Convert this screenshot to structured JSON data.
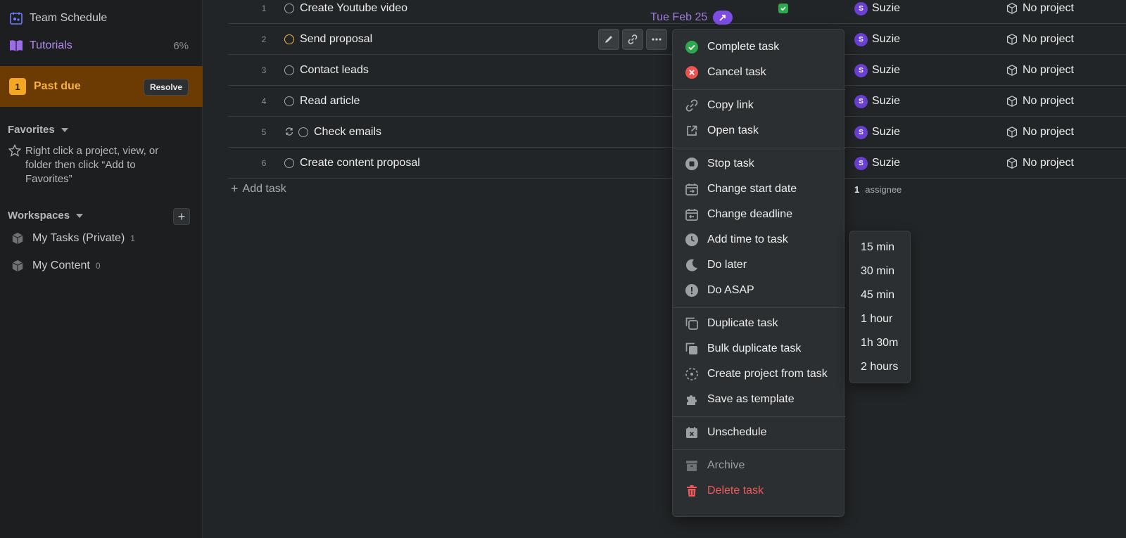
{
  "sidebar": {
    "team_schedule": "Team Schedule",
    "tutorials": "Tutorials",
    "tutorials_progress": "6%",
    "past_due": {
      "count": "1",
      "label": "Past due",
      "resolve": "Resolve"
    },
    "favorites": {
      "heading": "Favorites",
      "help": "Right click a project, view, or folder then click “Add to Favorites”"
    },
    "workspaces": {
      "heading": "Workspaces",
      "add": "+",
      "items": [
        {
          "label": "My Tasks (Private)",
          "count": "1"
        },
        {
          "label": "My Content",
          "count": "0"
        }
      ]
    }
  },
  "tasks": {
    "rows": [
      {
        "num": "1",
        "title": "Create Youtube video",
        "assignee": "Suzie",
        "avatar": "S",
        "project": "No project",
        "date": "Tue Feb 25"
      },
      {
        "num": "2",
        "title": "Send proposal",
        "assignee": "Suzie",
        "avatar": "S",
        "project": "No project"
      },
      {
        "num": "3",
        "title": "Contact leads",
        "assignee": "Suzie",
        "avatar": "S",
        "project": "No project"
      },
      {
        "num": "4",
        "title": "Read article",
        "assignee": "Suzie",
        "avatar": "S",
        "project": "No project"
      },
      {
        "num": "5",
        "title": "Check emails",
        "assignee": "Suzie",
        "avatar": "S",
        "project": "No project"
      },
      {
        "num": "6",
        "title": "Create content proposal",
        "assignee": "Suzie",
        "avatar": "S",
        "project": "No project"
      }
    ],
    "add_task": "Add task",
    "assignee_summary": {
      "count": "1",
      "label": "assignee"
    }
  },
  "context_menu": {
    "items": [
      {
        "label": "Complete task",
        "icon": "check-circle-icon"
      },
      {
        "label": "Cancel task",
        "icon": "x-circle-icon"
      },
      {
        "label": "Copy link",
        "icon": "link-icon"
      },
      {
        "label": "Open task",
        "icon": "external-link-icon"
      },
      {
        "label": "Stop task",
        "icon": "stop-icon"
      },
      {
        "label": "Change start date",
        "icon": "calendar-start-icon"
      },
      {
        "label": "Change deadline",
        "icon": "calendar-deadline-icon"
      },
      {
        "label": "Add time to task",
        "icon": "clock-icon"
      },
      {
        "label": "Do later",
        "icon": "moon-icon"
      },
      {
        "label": "Do ASAP",
        "icon": "exclamation-icon"
      },
      {
        "label": "Duplicate task",
        "icon": "duplicate-icon"
      },
      {
        "label": "Bulk duplicate task",
        "icon": "bulk-duplicate-icon"
      },
      {
        "label": "Create project from task",
        "icon": "dashed-circle-icon"
      },
      {
        "label": "Save as template",
        "icon": "puzzle-icon"
      },
      {
        "label": "Unschedule",
        "icon": "calendar-x-icon"
      },
      {
        "label": "Archive",
        "icon": "archive-icon"
      },
      {
        "label": "Delete task",
        "icon": "trash-icon"
      }
    ]
  },
  "time_submenu": {
    "options": [
      "15 min",
      "30 min",
      "45 min",
      "1 hour",
      "1h 30m",
      "2 hours"
    ]
  },
  "colors": {
    "accent_purple": "#7d4de6",
    "past_due_bg": "#6b3b03",
    "past_due_text": "#f8b140",
    "danger": "#ef5350",
    "success": "#2ea84f"
  }
}
